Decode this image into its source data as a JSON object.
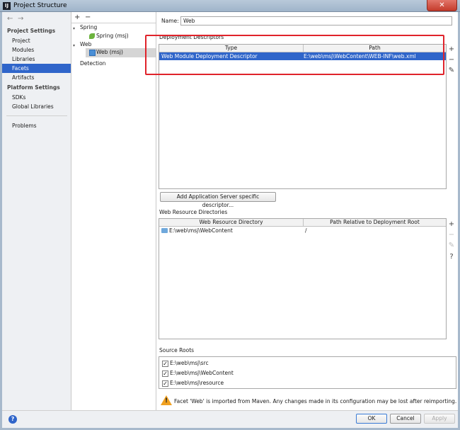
{
  "window": {
    "title": "Project Structure",
    "close_glyph": "✕"
  },
  "nav": {
    "back": "←",
    "forward": "→",
    "project_settings": "Project Settings",
    "items_project": [
      "Project",
      "Modules",
      "Libraries",
      "Facets",
      "Artifacts"
    ],
    "platform_settings": "Platform Settings",
    "items_platform": [
      "SDKs",
      "Global Libraries"
    ],
    "problems": "Problems",
    "selected": "Facets"
  },
  "tree": {
    "add": "+",
    "remove": "−",
    "spring_group": "Spring",
    "spring_item": "Spring (msj)",
    "web_group": "Web",
    "web_item": "Web (msj)",
    "detection": "Detection"
  },
  "form": {
    "name_label": "Name:",
    "name_value": "Web",
    "deployment_title": "Deployment Descriptors",
    "dd_columns": [
      "Type",
      "Path"
    ],
    "dd_rows": [
      {
        "type": "Web Module Deployment Descriptor",
        "path": "E:\\web\\msj\\WebContent\\WEB-INF\\web.xml"
      }
    ],
    "add_descriptor_button": "Add Application Server specific descriptor...",
    "resource_title": "Web Resource Directories",
    "wr_columns": [
      "Web Resource Directory",
      "Path Relative to Deployment Root"
    ],
    "wr_rows": [
      {
        "dir": "E:\\web\\msj\\WebContent",
        "rel": "/"
      }
    ],
    "source_roots_title": "Source Roots",
    "source_roots": [
      "E:\\web\\msj\\src",
      "E:\\web\\msj\\WebContent",
      "E:\\web\\msj\\resource"
    ],
    "warning": "Facet 'Web' is imported from Maven. Any changes made in its configuration may be lost after reimporting."
  },
  "tools": {
    "add": "+",
    "remove": "−",
    "edit": "✎",
    "help": "?"
  },
  "buttons": {
    "ok": "OK",
    "cancel": "Cancel",
    "apply": "Apply",
    "help": "?"
  },
  "colors": {
    "selection": "#2f65ca",
    "highlight_box": "#e0232b",
    "warning": "#f0a020"
  }
}
